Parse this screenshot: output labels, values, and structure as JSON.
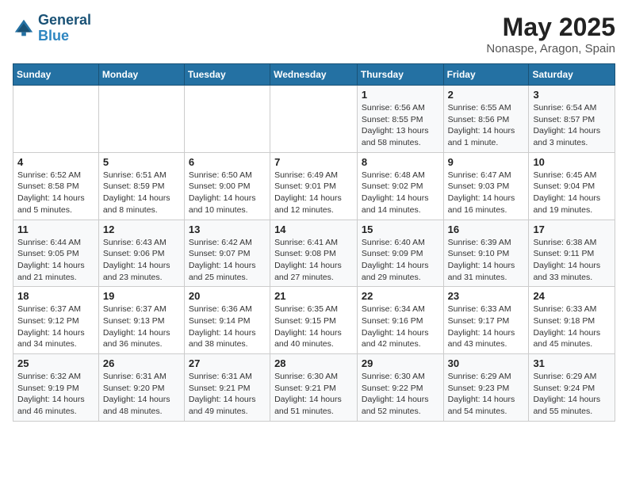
{
  "logo": {
    "line1": "General",
    "line2": "Blue"
  },
  "title": "May 2025",
  "location": "Nonaspe, Aragon, Spain",
  "days_of_week": [
    "Sunday",
    "Monday",
    "Tuesday",
    "Wednesday",
    "Thursday",
    "Friday",
    "Saturday"
  ],
  "weeks": [
    [
      {
        "day": "",
        "info": ""
      },
      {
        "day": "",
        "info": ""
      },
      {
        "day": "",
        "info": ""
      },
      {
        "day": "",
        "info": ""
      },
      {
        "day": "1",
        "info": "Sunrise: 6:56 AM\nSunset: 8:55 PM\nDaylight: 13 hours and 58 minutes."
      },
      {
        "day": "2",
        "info": "Sunrise: 6:55 AM\nSunset: 8:56 PM\nDaylight: 14 hours and 1 minute."
      },
      {
        "day": "3",
        "info": "Sunrise: 6:54 AM\nSunset: 8:57 PM\nDaylight: 14 hours and 3 minutes."
      }
    ],
    [
      {
        "day": "4",
        "info": "Sunrise: 6:52 AM\nSunset: 8:58 PM\nDaylight: 14 hours and 5 minutes."
      },
      {
        "day": "5",
        "info": "Sunrise: 6:51 AM\nSunset: 8:59 PM\nDaylight: 14 hours and 8 minutes."
      },
      {
        "day": "6",
        "info": "Sunrise: 6:50 AM\nSunset: 9:00 PM\nDaylight: 14 hours and 10 minutes."
      },
      {
        "day": "7",
        "info": "Sunrise: 6:49 AM\nSunset: 9:01 PM\nDaylight: 14 hours and 12 minutes."
      },
      {
        "day": "8",
        "info": "Sunrise: 6:48 AM\nSunset: 9:02 PM\nDaylight: 14 hours and 14 minutes."
      },
      {
        "day": "9",
        "info": "Sunrise: 6:47 AM\nSunset: 9:03 PM\nDaylight: 14 hours and 16 minutes."
      },
      {
        "day": "10",
        "info": "Sunrise: 6:45 AM\nSunset: 9:04 PM\nDaylight: 14 hours and 19 minutes."
      }
    ],
    [
      {
        "day": "11",
        "info": "Sunrise: 6:44 AM\nSunset: 9:05 PM\nDaylight: 14 hours and 21 minutes."
      },
      {
        "day": "12",
        "info": "Sunrise: 6:43 AM\nSunset: 9:06 PM\nDaylight: 14 hours and 23 minutes."
      },
      {
        "day": "13",
        "info": "Sunrise: 6:42 AM\nSunset: 9:07 PM\nDaylight: 14 hours and 25 minutes."
      },
      {
        "day": "14",
        "info": "Sunrise: 6:41 AM\nSunset: 9:08 PM\nDaylight: 14 hours and 27 minutes."
      },
      {
        "day": "15",
        "info": "Sunrise: 6:40 AM\nSunset: 9:09 PM\nDaylight: 14 hours and 29 minutes."
      },
      {
        "day": "16",
        "info": "Sunrise: 6:39 AM\nSunset: 9:10 PM\nDaylight: 14 hours and 31 minutes."
      },
      {
        "day": "17",
        "info": "Sunrise: 6:38 AM\nSunset: 9:11 PM\nDaylight: 14 hours and 33 minutes."
      }
    ],
    [
      {
        "day": "18",
        "info": "Sunrise: 6:37 AM\nSunset: 9:12 PM\nDaylight: 14 hours and 34 minutes."
      },
      {
        "day": "19",
        "info": "Sunrise: 6:37 AM\nSunset: 9:13 PM\nDaylight: 14 hours and 36 minutes."
      },
      {
        "day": "20",
        "info": "Sunrise: 6:36 AM\nSunset: 9:14 PM\nDaylight: 14 hours and 38 minutes."
      },
      {
        "day": "21",
        "info": "Sunrise: 6:35 AM\nSunset: 9:15 PM\nDaylight: 14 hours and 40 minutes."
      },
      {
        "day": "22",
        "info": "Sunrise: 6:34 AM\nSunset: 9:16 PM\nDaylight: 14 hours and 42 minutes."
      },
      {
        "day": "23",
        "info": "Sunrise: 6:33 AM\nSunset: 9:17 PM\nDaylight: 14 hours and 43 minutes."
      },
      {
        "day": "24",
        "info": "Sunrise: 6:33 AM\nSunset: 9:18 PM\nDaylight: 14 hours and 45 minutes."
      }
    ],
    [
      {
        "day": "25",
        "info": "Sunrise: 6:32 AM\nSunset: 9:19 PM\nDaylight: 14 hours and 46 minutes."
      },
      {
        "day": "26",
        "info": "Sunrise: 6:31 AM\nSunset: 9:20 PM\nDaylight: 14 hours and 48 minutes."
      },
      {
        "day": "27",
        "info": "Sunrise: 6:31 AM\nSunset: 9:21 PM\nDaylight: 14 hours and 49 minutes."
      },
      {
        "day": "28",
        "info": "Sunrise: 6:30 AM\nSunset: 9:21 PM\nDaylight: 14 hours and 51 minutes."
      },
      {
        "day": "29",
        "info": "Sunrise: 6:30 AM\nSunset: 9:22 PM\nDaylight: 14 hours and 52 minutes."
      },
      {
        "day": "30",
        "info": "Sunrise: 6:29 AM\nSunset: 9:23 PM\nDaylight: 14 hours and 54 minutes."
      },
      {
        "day": "31",
        "info": "Sunrise: 6:29 AM\nSunset: 9:24 PM\nDaylight: 14 hours and 55 minutes."
      }
    ]
  ]
}
